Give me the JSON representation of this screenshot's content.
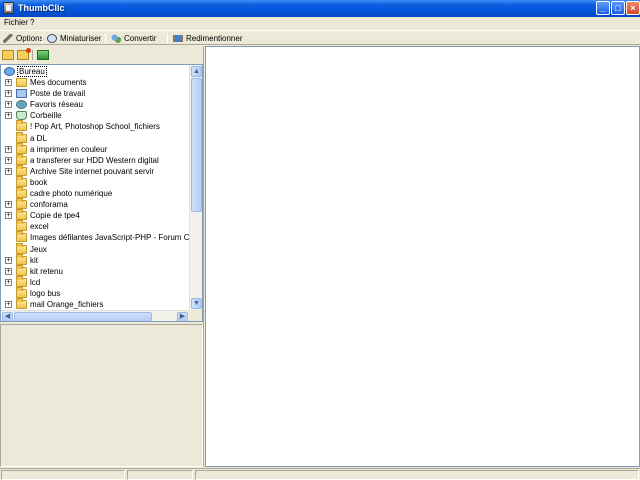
{
  "window": {
    "title": "ThumbClic",
    "minimize_label": "_",
    "maximize_label": "□",
    "close_label": "×"
  },
  "menu": {
    "items": [
      "Fichier",
      "?"
    ]
  },
  "toolbar": {
    "options_label": "Options",
    "miniaturiser_label": "Miniaturiser",
    "convertir_label": "Convertir",
    "redimensionner_label": "Redimentionner",
    "icons": [
      "wrench-icon",
      "magnifier-icon",
      "convert-icon",
      "resize-icon"
    ]
  },
  "tree": {
    "root_label": "Bureau",
    "items": [
      {
        "label": "Mes documents",
        "icon": "documents-icon",
        "expandable": true
      },
      {
        "label": "Poste de travail",
        "icon": "computer-icon",
        "expandable": true
      },
      {
        "label": "Favoris réseau",
        "icon": "network-icon",
        "expandable": true
      },
      {
        "label": "Corbeille",
        "icon": "recycle-bin-icon",
        "expandable": true
      },
      {
        "label": "! Pop Art, Photoshop School_fichiers",
        "icon": "folder-icon",
        "expandable": false
      },
      {
        "label": "a DL",
        "icon": "folder-icon",
        "expandable": false
      },
      {
        "label": "a imprimer en couleur",
        "icon": "folder-icon",
        "expandable": true
      },
      {
        "label": "a transferer sur HDD Western digital",
        "icon": "folder-icon",
        "expandable": true
      },
      {
        "label": "Archive Site internet pouvant servir",
        "icon": "folder-icon",
        "expandable": true
      },
      {
        "label": "book",
        "icon": "folder-icon",
        "expandable": false
      },
      {
        "label": "cadre photo numérique",
        "icon": "folder-icon",
        "expandable": false
      },
      {
        "label": "conforama",
        "icon": "folder-icon",
        "expandable": true
      },
      {
        "label": "Copie de tpe4",
        "icon": "folder-icon",
        "expandable": true
      },
      {
        "label": "excel",
        "icon": "folder-icon",
        "expandable": false
      },
      {
        "label": "Images défilantes JavaScript-PHP - Forum Codes Script",
        "icon": "folder-icon",
        "expandable": false
      },
      {
        "label": "Jeux",
        "icon": "folder-icon",
        "expandable": false
      },
      {
        "label": "kit",
        "icon": "folder-icon",
        "expandable": true
      },
      {
        "label": "kit retenu",
        "icon": "folder-icon",
        "expandable": true
      },
      {
        "label": "lcd",
        "icon": "folder-icon",
        "expandable": true
      },
      {
        "label": "logo bus",
        "icon": "folder-icon",
        "expandable": false
      },
      {
        "label": "mail Orange_fichiers",
        "icon": "folder-icon",
        "expandable": true
      }
    ]
  },
  "status": {
    "pane1": "",
    "pane2": "",
    "pane3": ""
  }
}
